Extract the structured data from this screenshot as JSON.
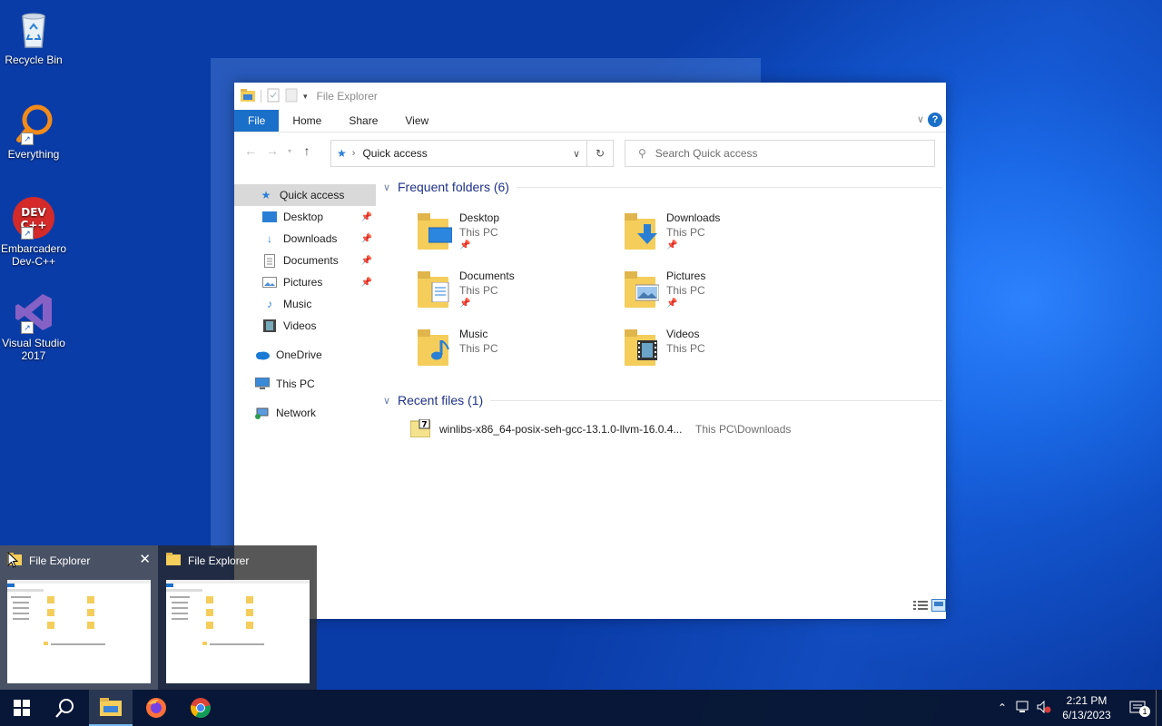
{
  "desktop": {
    "icons": [
      {
        "label": "Recycle Bin",
        "icon": "recycle-bin-icon"
      },
      {
        "label": "Everything",
        "icon": "magnifier-icon"
      },
      {
        "label": "Embarcadero Dev-C++",
        "icon": "devcpp-icon",
        "badge": "DEV C++"
      },
      {
        "label": "Visual Studio 2017",
        "icon": "visual-studio-icon"
      }
    ]
  },
  "explorer": {
    "title": "File Explorer",
    "ribbon_tabs": [
      "File",
      "Home",
      "Share",
      "View"
    ],
    "address": "Quick access",
    "search_placeholder": "Search Quick access",
    "nav": [
      {
        "label": "Quick access",
        "pinned": false,
        "selected": true
      },
      {
        "label": "Desktop",
        "pinned": true
      },
      {
        "label": "Downloads",
        "pinned": true
      },
      {
        "label": "Documents",
        "pinned": true
      },
      {
        "label": "Pictures",
        "pinned": true
      },
      {
        "label": "Music",
        "pinned": false
      },
      {
        "label": "Videos",
        "pinned": false
      },
      {
        "label": "OneDrive",
        "pinned": false
      },
      {
        "label": "This PC",
        "pinned": false
      },
      {
        "label": "Network",
        "pinned": false
      }
    ],
    "frequent_header": "Frequent folders (6)",
    "folders": [
      {
        "name": "Desktop",
        "location": "This PC",
        "pinned": true
      },
      {
        "name": "Downloads",
        "location": "This PC",
        "pinned": true
      },
      {
        "name": "Documents",
        "location": "This PC",
        "pinned": true
      },
      {
        "name": "Pictures",
        "location": "This PC",
        "pinned": true
      },
      {
        "name": "Music",
        "location": "This PC",
        "pinned": false
      },
      {
        "name": "Videos",
        "location": "This PC",
        "pinned": false
      }
    ],
    "recent_header": "Recent files (1)",
    "recent": [
      {
        "name": "winlibs-x86_64-posix-seh-gcc-13.1.0-llvm-16.0.4...",
        "location": "This PC\\Downloads"
      }
    ]
  },
  "preview": [
    {
      "title": "File Explorer"
    },
    {
      "title": "File Explorer"
    }
  ],
  "taskbar": {
    "time": "2:21 PM",
    "date": "6/13/2023",
    "notification_count": "1"
  },
  "colors": {
    "accent": "#1a6fc9",
    "folder": "#f4cd5b",
    "header": "#1e3287"
  }
}
